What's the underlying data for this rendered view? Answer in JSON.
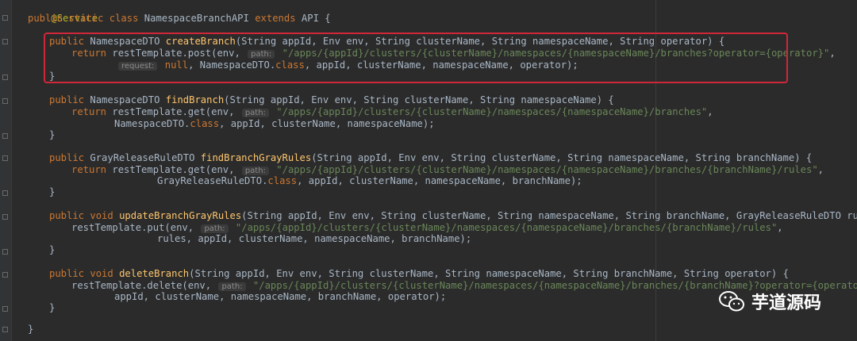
{
  "editor": {
    "line1": {
      "annotation": "@Service"
    },
    "line2": {
      "kw1": "public",
      "kw2": "static",
      "kw3": "class",
      "name": "NamespaceBranchAPI",
      "kw4": "extends",
      "rest": "API {"
    },
    "m1": {
      "sig_kw": "public",
      "sig_type": "NamespaceDTO",
      "sig_name": "createBranch",
      "sig_params": "(String appId, Env env, String clusterName, String namespaceName, String operator) {",
      "ret_kw": "return",
      "ret_obj": "restTemplate",
      "ret_call": ".post(env, ",
      "hint_path": "path:",
      "path_str": "\"/apps/{appId}/clusters/{clusterName}/namespaces/{namespaceName}/branches?operator={operator}\"",
      "path_tail": ",",
      "hint_request": "request:",
      "cont_null": "null",
      "cont_mid": ", NamespaceDTO.",
      "cont_class": "class",
      "cont_tail": ", appId, clusterName, namespaceName, operator);",
      "close": "}"
    },
    "m2": {
      "sig_kw": "public",
      "sig_type": "NamespaceDTO",
      "sig_name": "findBranch",
      "sig_params": "(String appId, Env env, String clusterName, String namespaceName) {",
      "ret_kw": "return",
      "ret_obj": "restTemplate",
      "ret_call": ".get(env, ",
      "hint_path": "path:",
      "path_str": "\"/apps/{appId}/clusters/{clusterName}/namespaces/{namespaceName}/branches\"",
      "path_tail": ",",
      "cont_mid": "NamespaceDTO.",
      "cont_class": "class",
      "cont_tail": ", appId, clusterName, namespaceName);",
      "close": "}"
    },
    "m3": {
      "sig_kw": "public",
      "sig_type": "GrayReleaseRuleDTO",
      "sig_name": "findBranchGrayRules",
      "sig_params": "(String appId, Env env, String clusterName, String namespaceName, String branchName) {",
      "ret_kw": "return",
      "ret_obj": "restTemplate",
      "ret_call": ".get(env, ",
      "hint_path": "path:",
      "path_str": "\"/apps/{appId}/clusters/{clusterName}/namespaces/{namespaceName}/branches/{branchName}/rules\"",
      "path_tail": ",",
      "cont_mid": "GrayReleaseRuleDTO.",
      "cont_class": "class",
      "cont_tail": ", appId, clusterName, namespaceName, branchName);",
      "close": "}"
    },
    "m4": {
      "sig_kw1": "public",
      "sig_kw2": "void",
      "sig_name": "updateBranchGrayRules",
      "sig_params": "(String appId, Env env, String clusterName, String namespaceName, String branchName, GrayReleaseRuleDTO rules) {",
      "ret_obj": "restTemplate",
      "ret_call": ".put(env, ",
      "hint_path": "path:",
      "path_str": "\"/apps/{appId}/clusters/{clusterName}/namespaces/{namespaceName}/branches/{branchName}/rules\"",
      "path_tail": ",",
      "cont": "rules, appId, clusterName, namespaceName, branchName);",
      "close": "}"
    },
    "m5": {
      "sig_kw1": "public",
      "sig_kw2": "void",
      "sig_name": "deleteBranch",
      "sig_params": "(String appId, Env env, String clusterName, String namespaceName, String branchName, String operator) {",
      "ret_obj": "restTemplate",
      "ret_call": ".delete(env, ",
      "hint_path": "path:",
      "path_str": "\"/apps/{appId}/clusters/{clusterName}/namespaces/{namespaceName}/branches/{branchName}?operator={operator}\"",
      "path_tail": ",",
      "cont": "appId, clusterName, namespaceName, branchName, operator);",
      "close": "}"
    },
    "class_close": "}"
  },
  "watermark": {
    "text": "芋道源码",
    "icon": "wechat-icon"
  },
  "colors": {
    "background": "#2b2b2b",
    "keyword": "#cc7832",
    "method": "#ffc66d",
    "string": "#6a8759",
    "annotation": "#bbb529",
    "highlight": "#d0263a"
  }
}
